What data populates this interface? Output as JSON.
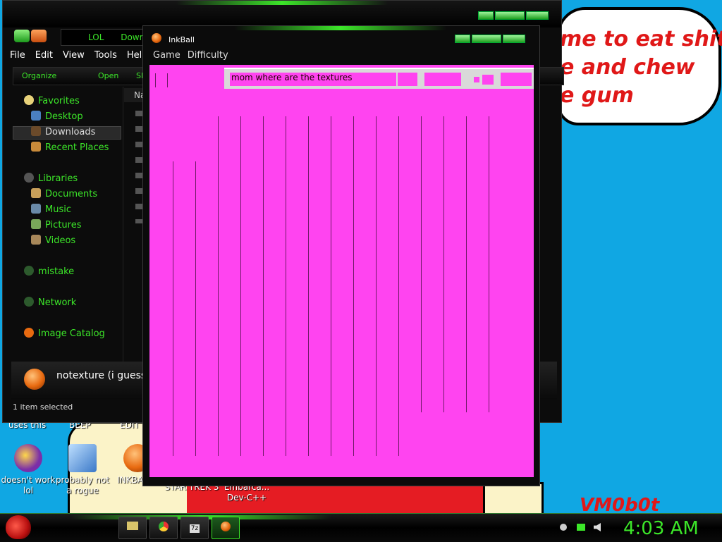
{
  "wallpaper": {
    "bubble_lines": [
      "me to eat shit",
      "e and chew",
      "e gum"
    ],
    "signature": "VM0b0t"
  },
  "desktop_icons": [
    {
      "label": "doesn't work lol",
      "icon": "yahoo-messenger-icon",
      "color": "#7b2ea8"
    },
    {
      "label": "probably not a rogue",
      "icon": "control-panel-icon",
      "color": "#3a78c8"
    },
    {
      "label": "INKBALLS",
      "icon": "inkball-icon",
      "color": "#e86a10"
    },
    {
      "label": "STAR TREK 3",
      "icon": "",
      "color": ""
    },
    {
      "label": "Embarca... Dev-C++",
      "icon": "",
      "color": ""
    }
  ],
  "desktop_top_labels": [
    "uses this",
    "BEEP",
    "EDIT"
  ],
  "explorer": {
    "breadcrumb": [
      "LOL",
      "Down"
    ],
    "menu": [
      "File",
      "Edit",
      "View",
      "Tools",
      "Hel"
    ],
    "toolbar": {
      "organize": "Organize",
      "open": "Open",
      "share": "Sh"
    },
    "column_header": "Na",
    "nav": {
      "favorites": "Favorites",
      "desktop": "Desktop",
      "downloads": "Downloads",
      "recent": "Recent Places",
      "libraries": "Libraries",
      "documents": "Documents",
      "music": "Music",
      "pictures": "Pictures",
      "videos": "Videos",
      "mistake": "mistake",
      "network": "Network",
      "image_catalog": "Image Catalog"
    },
    "details_filename": "notexture (i guess).e",
    "status": "1 item selected"
  },
  "inkball": {
    "title": "InkBall",
    "menu": [
      "Game",
      "Difficulty"
    ],
    "hud_text": "mom where are the textures",
    "board_color": "#ff44f0"
  },
  "taskbar": {
    "clock": "4:03 AM",
    "buttons": [
      "folder-icon",
      "chrome-icon",
      "7z",
      "inkball-icon"
    ],
    "tray": [
      "chevron-icon",
      "network-icon",
      "volume-icon"
    ]
  }
}
